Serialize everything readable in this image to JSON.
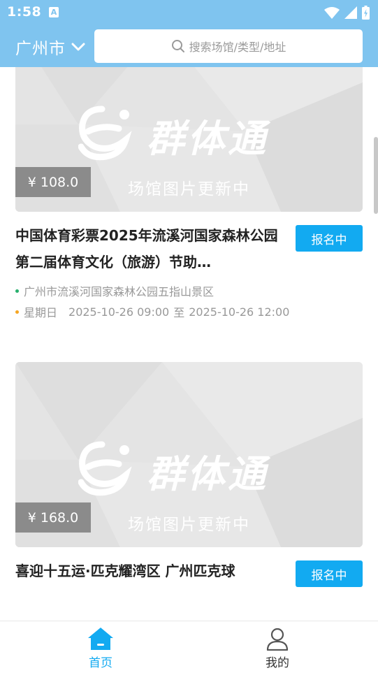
{
  "status_bar": {
    "time": "1:58",
    "notification_icon": "a-letter-icon",
    "icons": [
      "wifi-icon",
      "signal-icon",
      "battery-charging-icon"
    ]
  },
  "header": {
    "city": "广州市",
    "city_icon": "chevron-down-icon",
    "search_placeholder": "搜索场馆/类型/地址",
    "search_icon": "search-icon",
    "background_color": "#7fc4ef"
  },
  "events": [
    {
      "brand_name": "群体通",
      "image_placeholder": "场馆图片更新中",
      "price": "¥ 108.0",
      "title": "中国体育彩票2025年流溪河国家森林公园第二届体育文化（旅游）节助…",
      "status": "报名中",
      "location": "广州市流溪河国家森林公园五指山景区",
      "weekday": "星期日",
      "start": "2025-10-26 09:00",
      "to": "至",
      "end": "2025-10-26 12:00"
    },
    {
      "brand_name": "群体通",
      "image_placeholder": "场馆图片更新中",
      "price": "¥ 168.0",
      "title": "喜迎十五运·匹克耀湾区 广州匹克球",
      "status": "报名中"
    }
  ],
  "bottom_nav": {
    "items": [
      {
        "label": "首页",
        "icon": "home-icon",
        "active": true
      },
      {
        "label": "我的",
        "icon": "user-icon",
        "active": false
      }
    ],
    "active_color": "#12aaf1"
  },
  "accent_color": "#12aaf1"
}
